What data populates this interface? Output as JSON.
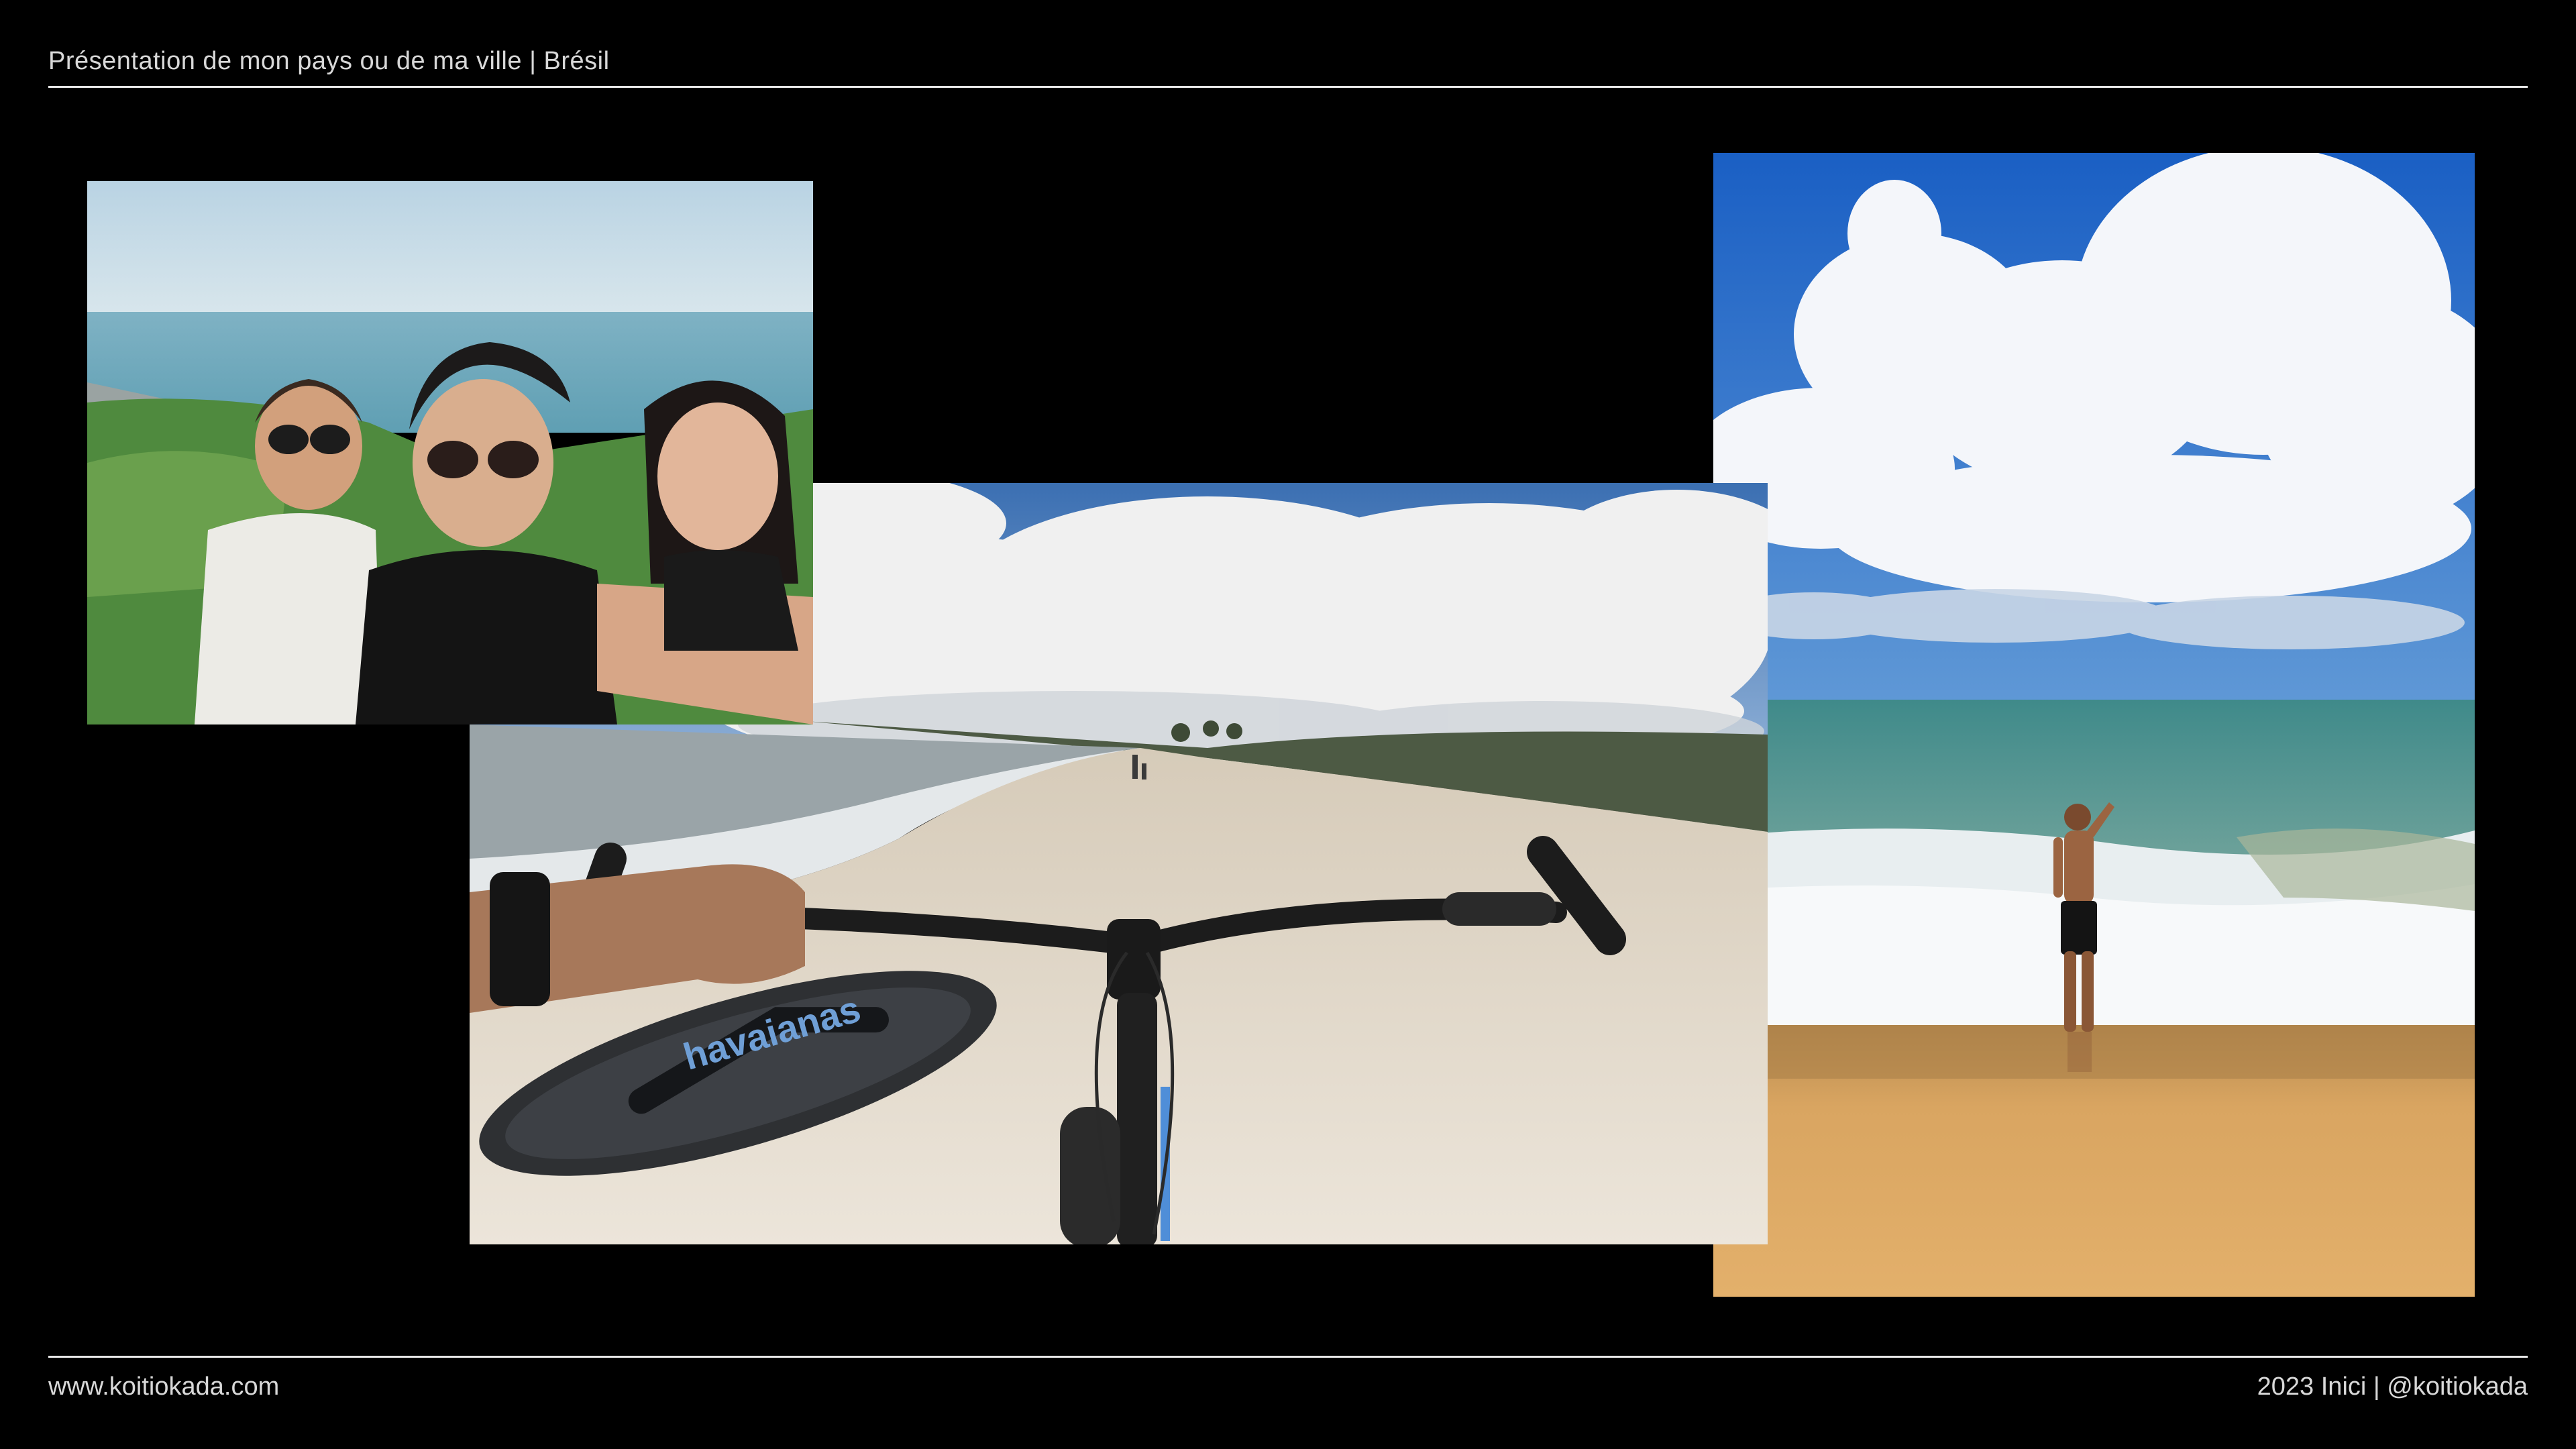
{
  "header": {
    "title": "Présentation de mon pays ou de ma ville | Brésil"
  },
  "footer": {
    "website": "www.koitiokada.com",
    "credit": "2023 Inici | @koitiokada"
  },
  "photos": {
    "left": {
      "caption": "havaianas"
    },
    "center": {
      "sandal_brand": "havaianas"
    }
  },
  "colors": {
    "background": "#000000",
    "text": "#d8d8d8",
    "rule": "#e6e6e6"
  }
}
